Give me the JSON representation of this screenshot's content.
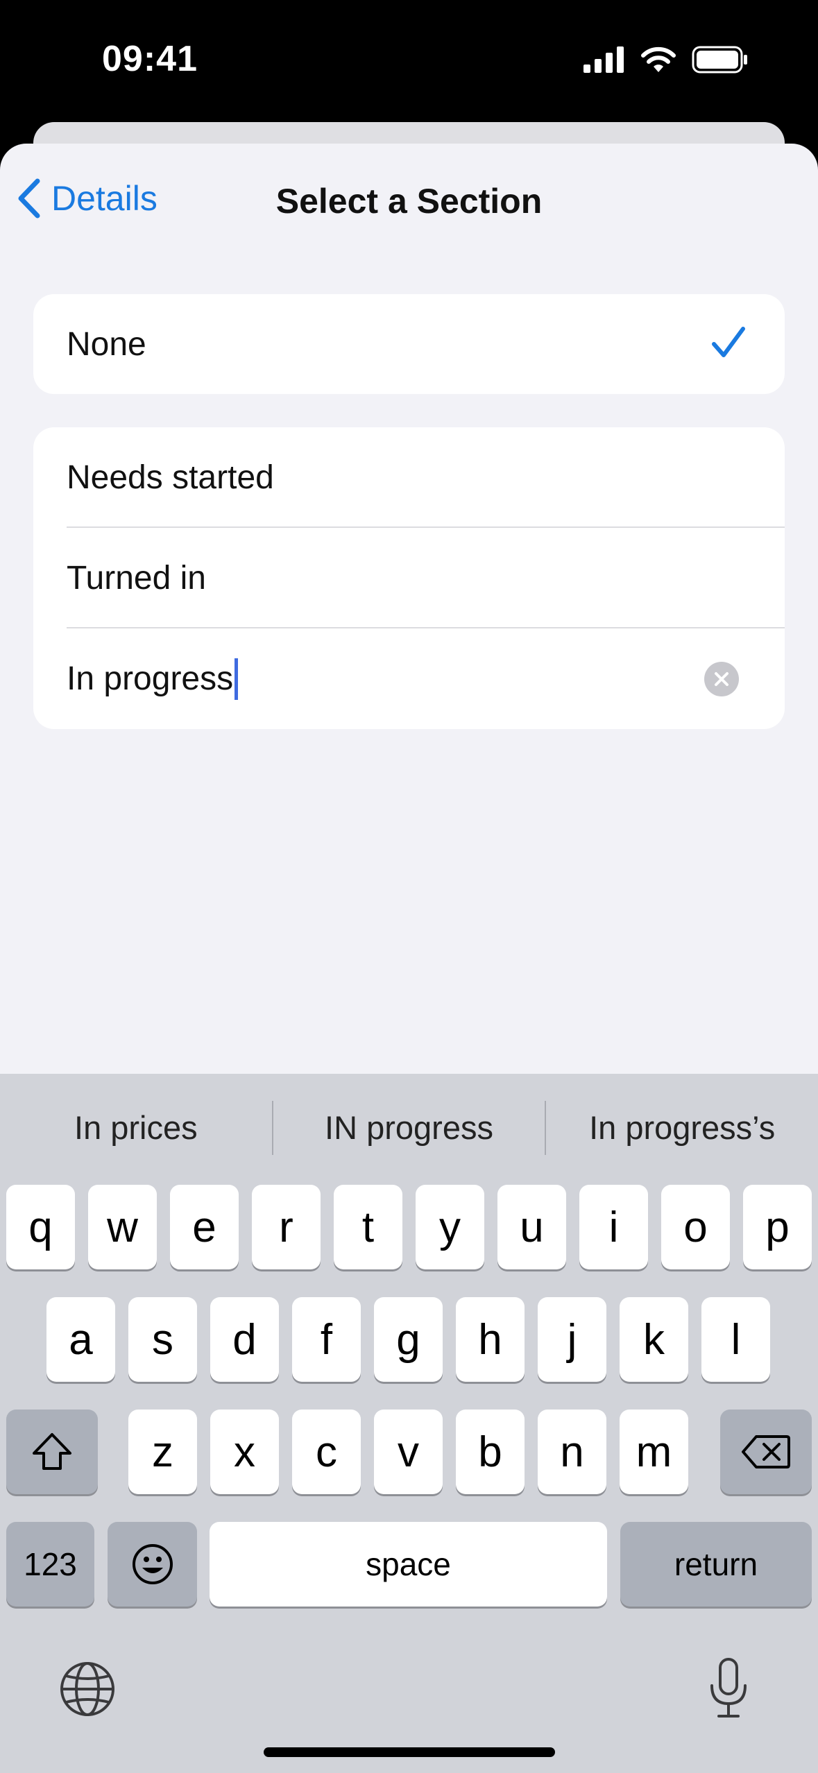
{
  "status": {
    "time": "09:41"
  },
  "nav": {
    "back_label": "Details",
    "title": "Select a Section"
  },
  "none_option": {
    "label": "None",
    "selected": true
  },
  "sections": [
    {
      "label": "Needs started"
    },
    {
      "label": "Turned in"
    }
  ],
  "editing": {
    "value": "In progress"
  },
  "suggestions": [
    "In prices",
    "IN progress",
    "In progress’s"
  ],
  "keyboard": {
    "row1": [
      "q",
      "w",
      "e",
      "r",
      "t",
      "y",
      "u",
      "i",
      "o",
      "p"
    ],
    "row2": [
      "a",
      "s",
      "d",
      "f",
      "g",
      "h",
      "j",
      "k",
      "l"
    ],
    "row3": [
      "z",
      "x",
      "c",
      "v",
      "b",
      "n",
      "m"
    ],
    "numbers_label": "123",
    "space_label": "space",
    "return_label": "return"
  },
  "colors": {
    "accent": "#1a7ae0",
    "background": "#f2f2f7",
    "keyboard": "#d1d3d9"
  }
}
